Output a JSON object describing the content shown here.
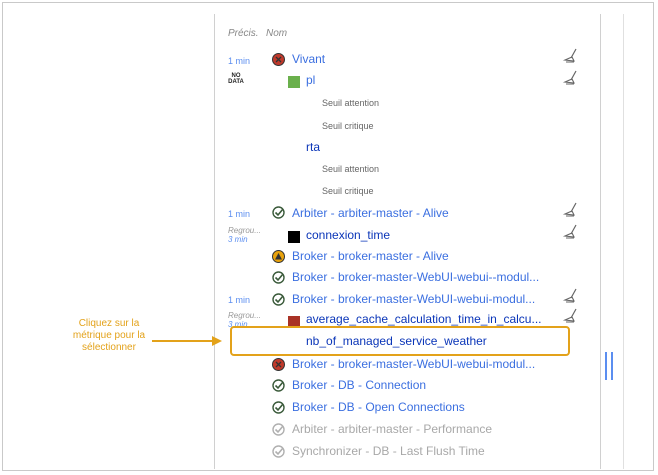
{
  "header": {
    "precision_label": "Précis.",
    "name_label": "Nom"
  },
  "rows": [
    {
      "prec": "1 min",
      "name": "Vivant"
    },
    {
      "prec": "",
      "nodata_top": "NO",
      "nodata_bottom": "DATA",
      "name": "pl"
    },
    {
      "name": "Seuil attention"
    },
    {
      "name": "Seuil critique"
    },
    {
      "name": "rta"
    },
    {
      "name": "Seuil attention"
    },
    {
      "name": "Seuil critique"
    },
    {
      "prec": "1 min",
      "name": "Arbiter - arbiter-master - Alive"
    },
    {
      "prec_top": "Regrou...",
      "prec_sub": "3 min",
      "name": "connexion_time"
    },
    {
      "name": "Broker - broker-master - Alive"
    },
    {
      "name": "Broker - broker-master-WebUI-webui--modul..."
    },
    {
      "prec": "1 min",
      "name": "Broker - broker-master-WebUI-webui-modul..."
    },
    {
      "prec_top": "Regrou...",
      "prec_sub": "3 min",
      "name": "average_cache_calculation_time_in_calcu..."
    },
    {
      "name": "nb_of_managed_service_weather"
    },
    {
      "name": "Broker - broker-master-WebUI-webui-modul..."
    },
    {
      "name": "Broker - DB - Connection"
    },
    {
      "name": "Broker - DB - Open Connections"
    },
    {
      "name": "Arbiter - arbiter-master - Performance"
    },
    {
      "name": "Synchronizer - DB - Last Flush Time"
    }
  ],
  "callout": {
    "line1": "Cliquez sur la",
    "line2": "métrique pour la",
    "line3": "sélectionner"
  },
  "colors": {
    "accent": "#e3a21a",
    "link": "#3b6fe0",
    "ok": "#3a5a3a",
    "critical": "#c0392b",
    "warning": "#e8a20c",
    "green_square": "#6ab04c"
  }
}
